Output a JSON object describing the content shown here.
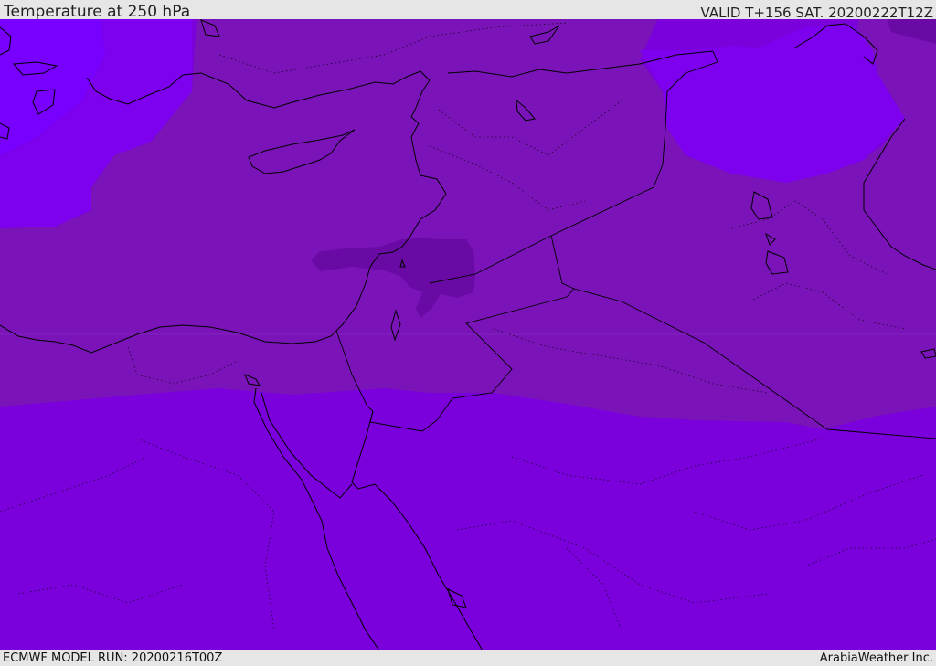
{
  "header": {
    "title": "Temperature at 250 hPa",
    "valid": "VALID T+156 SAT. 20200222T12Z"
  },
  "footer": {
    "model_run": "ECMWF MODEL RUN: 20200216T00Z",
    "credit": "ArabiaWeather Inc."
  },
  "colors": {
    "background": "#7a00dc",
    "band_lighter": "#7d00ee",
    "band_mid": "#7a14b8",
    "band_dark": "#6a0aa4",
    "band_violet": "#7700ff",
    "coastline": "#000000"
  }
}
